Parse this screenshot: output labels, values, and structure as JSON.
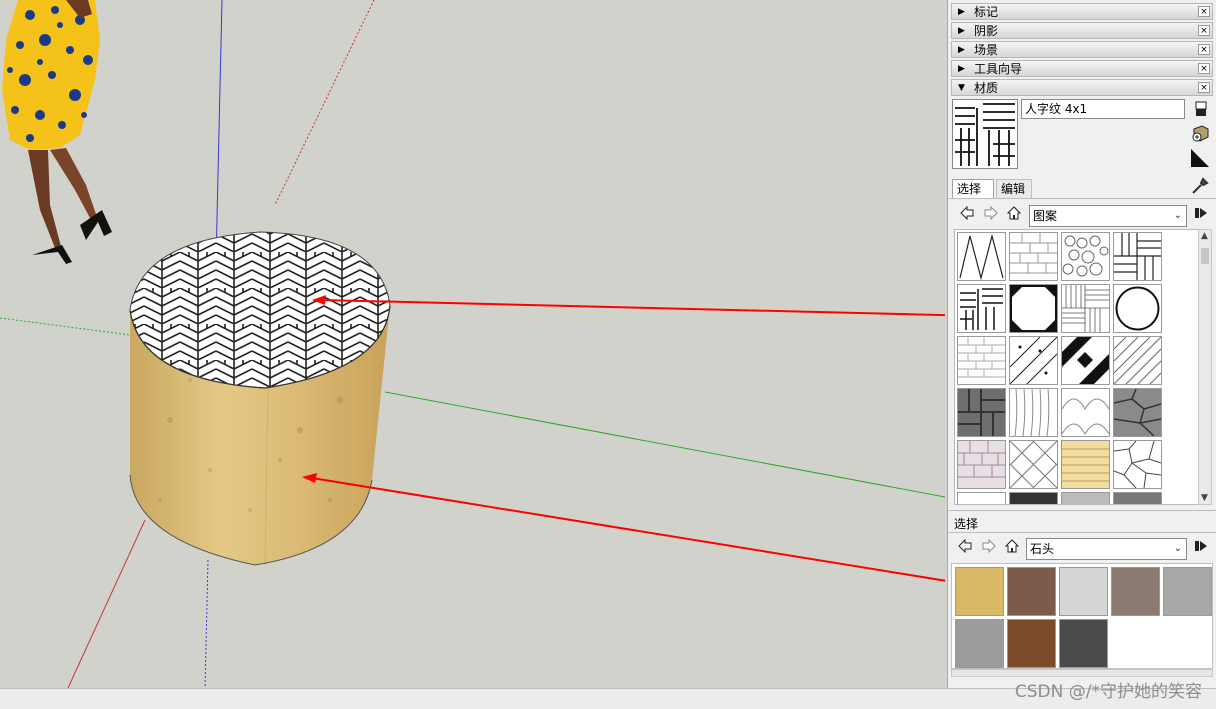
{
  "tray": {
    "panels": [
      {
        "title": "标记",
        "expanded": false
      },
      {
        "title": "阴影",
        "expanded": false
      },
      {
        "title": "场景",
        "expanded": false
      },
      {
        "title": "工具向导",
        "expanded": false
      },
      {
        "title": "材质",
        "expanded": true
      }
    ],
    "close_glyph": "×",
    "collapsed_glyph": "▶",
    "expanded_glyph": "▼"
  },
  "materials": {
    "current_name": "人字纹 4x1",
    "tabs": {
      "select": "选择",
      "edit": "编辑"
    },
    "top_collection": "图案",
    "bottom_label": "选择",
    "bottom_collection": "石头",
    "pattern_thumbnails": [
      "zigzag",
      "brick-light",
      "cobble",
      "basketweave",
      "herringbone",
      "octagon",
      "parquet",
      "circle",
      "brick-white",
      "diagonal-dots",
      "checker-diag",
      "hatch-diagonal",
      "stone-blocks-dark",
      "wood-lines",
      "fish-scale",
      "flagstone-gray",
      "shingle",
      "diamond-lattice",
      "wood-planks",
      "irregular-stone"
    ],
    "stone_swatches": [
      {
        "name": "sandstone",
        "color": "#d9b866"
      },
      {
        "name": "brown-granite",
        "color": "#7d5a4a"
      },
      {
        "name": "white-marble",
        "color": "#d6d6d6"
      },
      {
        "name": "gray-granite",
        "color": "#8a7a72"
      },
      {
        "name": "light-granite",
        "color": "#a8a8a8"
      },
      {
        "name": "concrete",
        "color": "#9c9c9c"
      },
      {
        "name": "brown-stone",
        "color": "#7a4c2a"
      },
      {
        "name": "dark-stone",
        "color": "#4a4a4a"
      }
    ]
  },
  "watermark": "CSDN @/*守护她的笑容",
  "colors": {
    "arrow": "#ff0000",
    "axis_blue": "#3a3ad0",
    "axis_green": "#2fa82f",
    "axis_red": "#cc3333"
  }
}
